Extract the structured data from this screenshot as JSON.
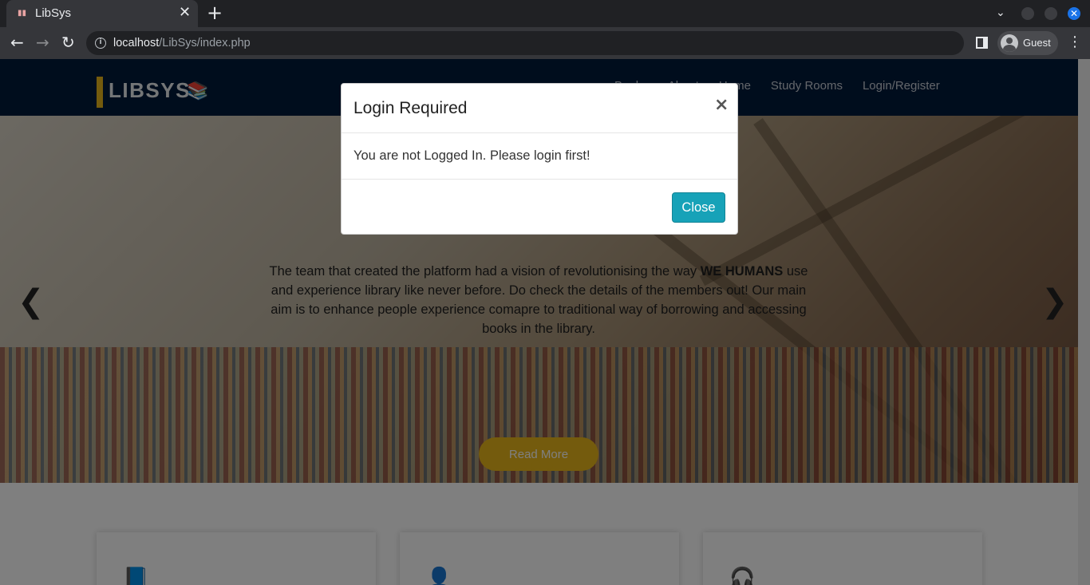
{
  "browser": {
    "tab_title": "LibSys",
    "tab_close": "✕",
    "new_tab": "+",
    "url_host": "localhost",
    "url_path": "/LibSys/index.php",
    "profile_label": "Guest",
    "back": "←",
    "forward": "→",
    "reload": "↻",
    "menu": "⋮",
    "tab_search": "⌄",
    "window_close": "✕"
  },
  "site": {
    "logo": "LIBSYS",
    "nav": [
      {
        "label": "Books"
      },
      {
        "label": "About"
      },
      {
        "label": "Home"
      },
      {
        "label": "Study Rooms"
      },
      {
        "label": "Login/Register"
      }
    ],
    "hero": {
      "text_before": "The team that created the platform had a vision of revolutionising the way ",
      "text_bold": "WE HUMANS",
      "text_after": " use and experience library like never before. Do check the details of the members out! Our main aim is to enhance people experience comapre to traditional way of borrowing and accessing books in the library.",
      "button": "Read More",
      "prev": "❮",
      "next": "❯",
      "slides": 3,
      "active_slide": 2
    },
    "accent_color": "#e8b71a",
    "navbar_color": "#001b3b"
  },
  "modal": {
    "title": "Login Required",
    "close_x": "×",
    "message": "You are not Logged In. Please login first!",
    "close_button": "Close",
    "button_color": "#17a2b8"
  }
}
